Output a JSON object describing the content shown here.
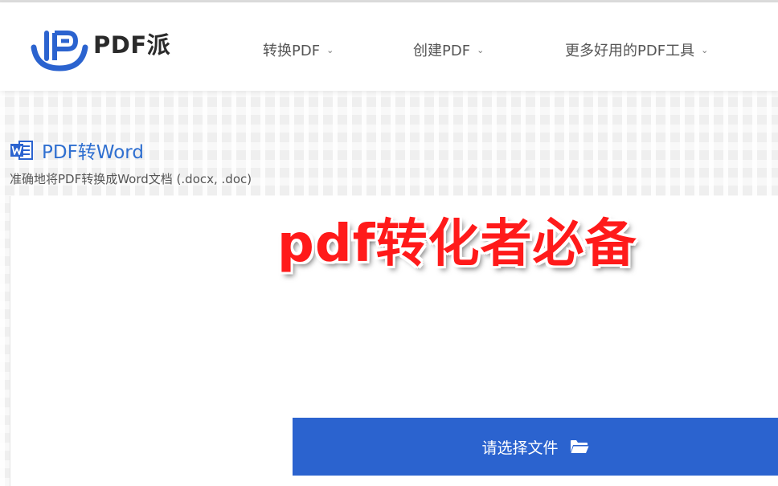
{
  "header": {
    "brand": "PDF派",
    "nav": [
      {
        "label": "转换PDF"
      },
      {
        "label": "创建PDF"
      },
      {
        "label": "更多好用的PDF工具"
      }
    ]
  },
  "tool": {
    "title": "PDF转Word",
    "description": "准确地将PDF转换成Word文档 (.docx, .doc)",
    "icon": "word-icon"
  },
  "overlay": {
    "text": "pdf转化者必备"
  },
  "upload": {
    "button_label": "请选择文件",
    "icon": "folder-open-icon"
  },
  "colors": {
    "accent": "#2b63cf",
    "title_blue": "#2f6fd0",
    "overlay_red": "#ff1a1a"
  }
}
